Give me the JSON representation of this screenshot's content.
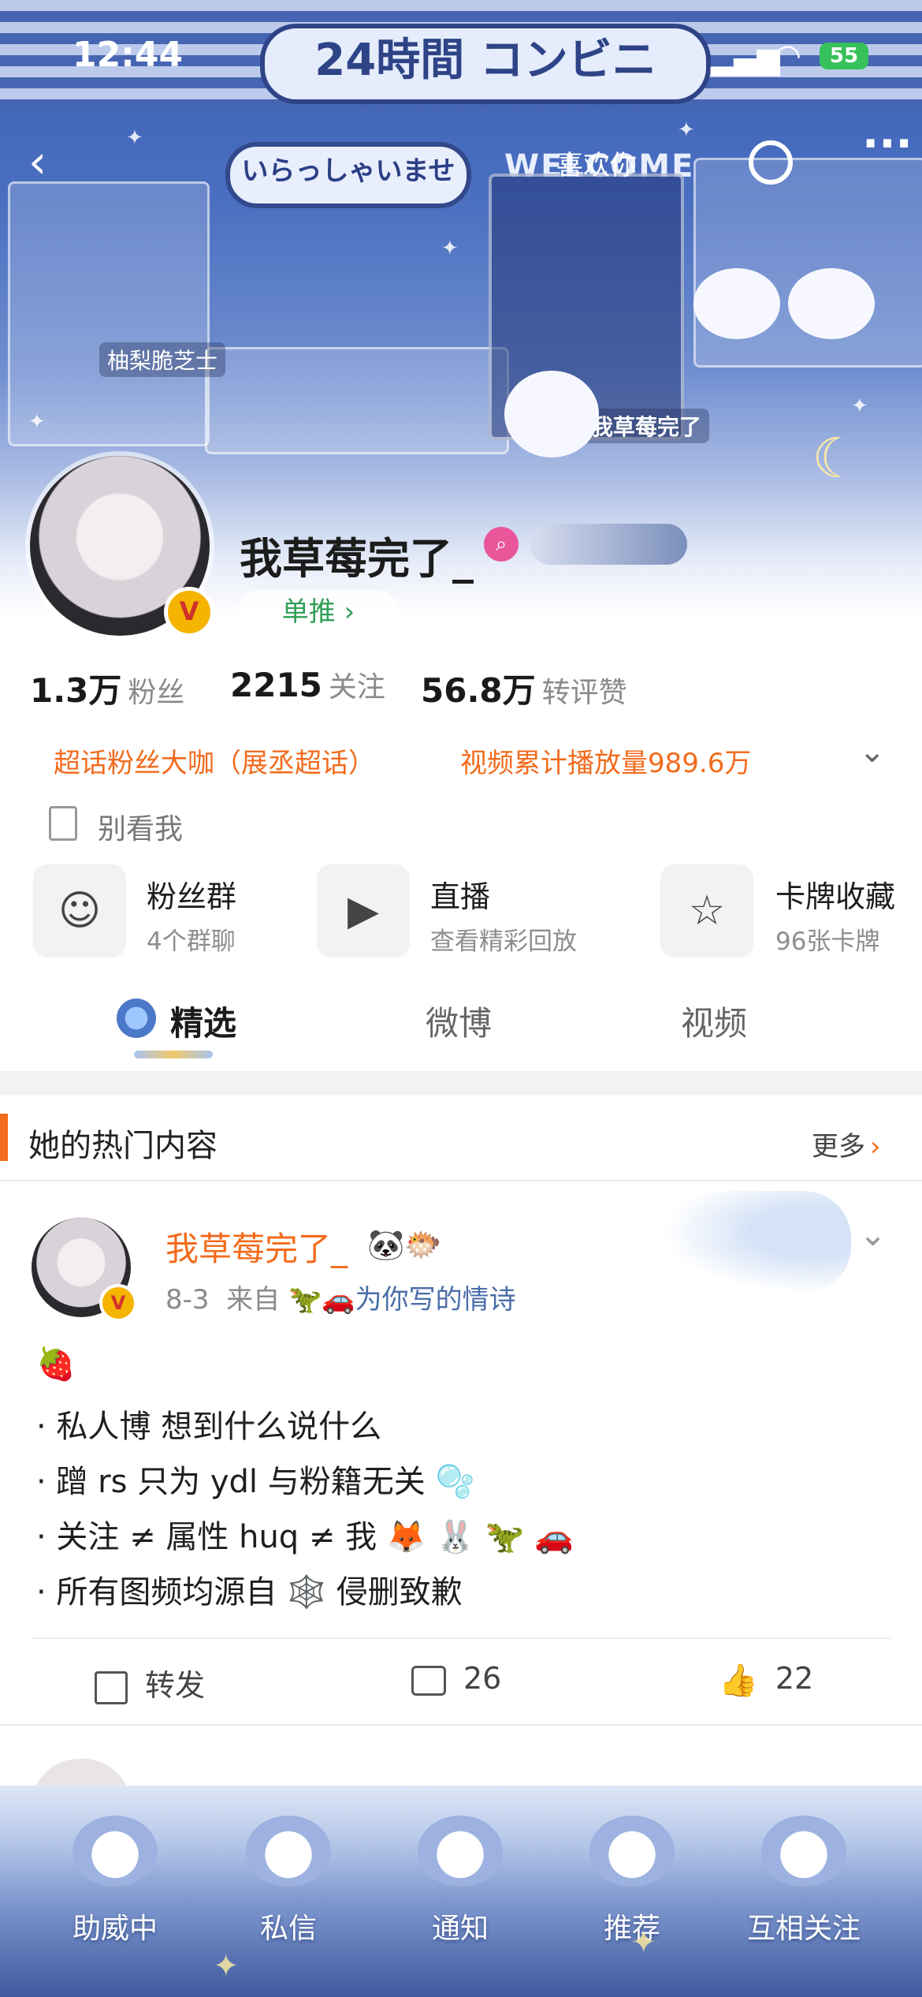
{
  "status": {
    "time": "12:44",
    "battery": "55"
  },
  "banner": {
    "sign_top": "24時間 コンビニ",
    "sign_welcome_jp": "いらっしゃいませ",
    "sign_welcome_en": "WELCOME",
    "tag_user": "柚梨脆芝士",
    "tag_user2": "我草莓完了",
    "nav_hint": "喜欢你"
  },
  "profile": {
    "username": "我草莓完了_",
    "danpush_label": "单推 ›",
    "stats": [
      {
        "num": "1.3万",
        "label": "粉丝"
      },
      {
        "num": "2215",
        "label": "关注"
      },
      {
        "num": "56.8万",
        "label": "转评赞"
      }
    ],
    "badge_left": "超话粉丝大咖（展丞超话）",
    "badge_right": "视频累计播放量989.6万",
    "bio": "别看我"
  },
  "cards": [
    {
      "title": "粉丝群",
      "sub": "4个群聊",
      "icon": "people-icon"
    },
    {
      "title": "直播",
      "sub": "查看精彩回放",
      "icon": "tv-icon"
    },
    {
      "title": "卡牌收藏",
      "sub": "96张卡牌",
      "icon": "card-icon"
    }
  ],
  "tabs": [
    "精选",
    "微博",
    "视频"
  ],
  "hot": {
    "title": "她的热门内容",
    "more": "更多"
  },
  "post": {
    "name": "我草莓完了_",
    "meta_date": "8-3",
    "meta_from": "来自",
    "meta_source": "为你写的情诗",
    "lines": [
      "🍓",
      "· 私人博 想到什么说什么",
      "· 蹭 rs 只为 ydl 与粉籍无关 🫧",
      "· 关注 ≠ 属性  huq ≠ 我 🦊 🐰  🦖 🚗",
      "· 所有图频均源自 🕸️  侵删致歉"
    ],
    "actions": {
      "repost": "转发",
      "comments": "26",
      "likes": "22"
    }
  },
  "bottom_nav": [
    "助威中",
    "私信",
    "通知",
    "推荐",
    "互相关注"
  ],
  "colors": {
    "accent": "#f26b1d",
    "banner": "#4b6fc0",
    "verified": "#f5b400"
  }
}
